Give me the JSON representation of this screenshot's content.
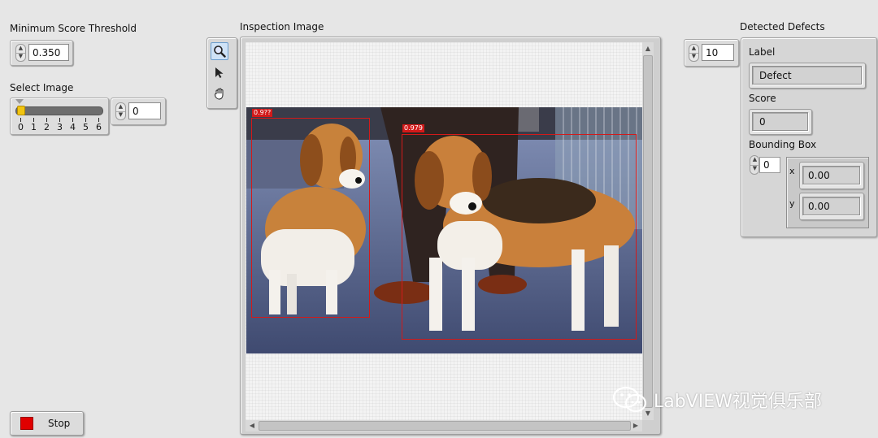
{
  "threshold": {
    "label": "Minimum Score Threshold",
    "value": "0.350"
  },
  "select_image": {
    "label": "Select Image",
    "slider_value": 0,
    "slider_min": 0,
    "slider_max": 6,
    "tick_labels": [
      "0",
      "1",
      "2",
      "3",
      "4",
      "5",
      "6"
    ],
    "numeric_value": "0"
  },
  "toolbar": {
    "tools": [
      {
        "icon": "magnifier-icon",
        "active": true
      },
      {
        "icon": "pointer-icon",
        "active": false
      },
      {
        "icon": "hand-icon",
        "active": false
      }
    ]
  },
  "inspection": {
    "label": "Inspection Image",
    "detections": [
      {
        "score": "0.9??",
        "box_color": "#d21a1a"
      },
      {
        "score": "0.979",
        "box_color": "#d21a1a"
      }
    ]
  },
  "defects": {
    "label": "Detected Defects",
    "index_value": "10",
    "label_field_caption": "Label",
    "label_value": "Defect",
    "score_caption": "Score",
    "score_value": "0",
    "bbox_caption": "Bounding Box",
    "bbox_index": "0",
    "x_label": "x",
    "x_value": "0.00",
    "y_label": "y",
    "y_value": "0.00"
  },
  "stop_button": {
    "label": "Stop",
    "led_color": "#e00000"
  },
  "watermark": {
    "text": "LabVIEW视觉俱乐部",
    "icon": "wechat-icon"
  }
}
